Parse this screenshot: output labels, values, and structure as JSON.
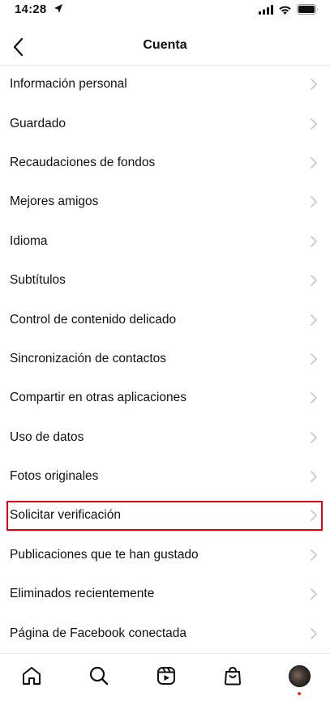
{
  "status": {
    "time": "14:28"
  },
  "header": {
    "title": "Cuenta"
  },
  "menu": {
    "items": [
      {
        "label": "Información personal"
      },
      {
        "label": "Guardado"
      },
      {
        "label": "Recaudaciones de fondos"
      },
      {
        "label": "Mejores amigos"
      },
      {
        "label": "Idioma"
      },
      {
        "label": "Subtítulos"
      },
      {
        "label": "Control de contenido delicado"
      },
      {
        "label": "Sincronización de contactos"
      },
      {
        "label": "Compartir en otras aplicaciones"
      },
      {
        "label": "Uso de datos"
      },
      {
        "label": "Fotos originales"
      },
      {
        "label": "Solicitar verificación",
        "highlighted": true
      },
      {
        "label": "Publicaciones que te han gustado"
      },
      {
        "label": "Eliminados recientemente"
      },
      {
        "label": "Página de Facebook conectada"
      }
    ]
  },
  "tab_bar": {
    "tabs": [
      "home-icon",
      "search-icon",
      "reels-icon",
      "shop-icon",
      "profile-avatar"
    ]
  },
  "colors": {
    "highlight": "#e00012",
    "notification": "#ff2d2d",
    "chevron": "#c7c7cc"
  }
}
